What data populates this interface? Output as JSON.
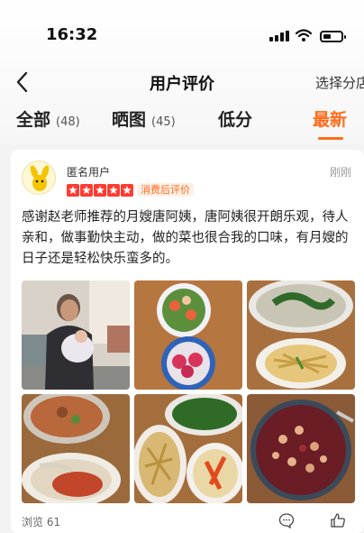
{
  "status_bar": {
    "time": "16:32"
  },
  "nav": {
    "title": "用户评价",
    "action_label": "选择分店"
  },
  "tabs": [
    {
      "label": "全部",
      "count": "(48)"
    },
    {
      "label": "晒图",
      "count": "(45)"
    },
    {
      "label": "低分",
      "count": ""
    },
    {
      "label": "最新",
      "count": ""
    }
  ],
  "active_tab": "最新",
  "review": {
    "user_name": "匿名用户",
    "rating": 5,
    "badge": "消费后评价",
    "time": "刚刚",
    "text": "感谢赵老师推荐的月嫂唐阿姨，唐阿姨很开朗乐观，待人亲和，做事勤快主动，做的菜也很合我的口味，有月嫂的日子还是轻松快乐蛮多的。",
    "photo_count": 6,
    "views_label": "浏览 61"
  },
  "colors": {
    "accent": "#ff6b1a",
    "star": "#ff3b30"
  },
  "icons": [
    "back-arrow-icon",
    "signal-icon",
    "wifi-icon",
    "battery-icon",
    "star-icon",
    "comment-icon",
    "like-icon"
  ]
}
